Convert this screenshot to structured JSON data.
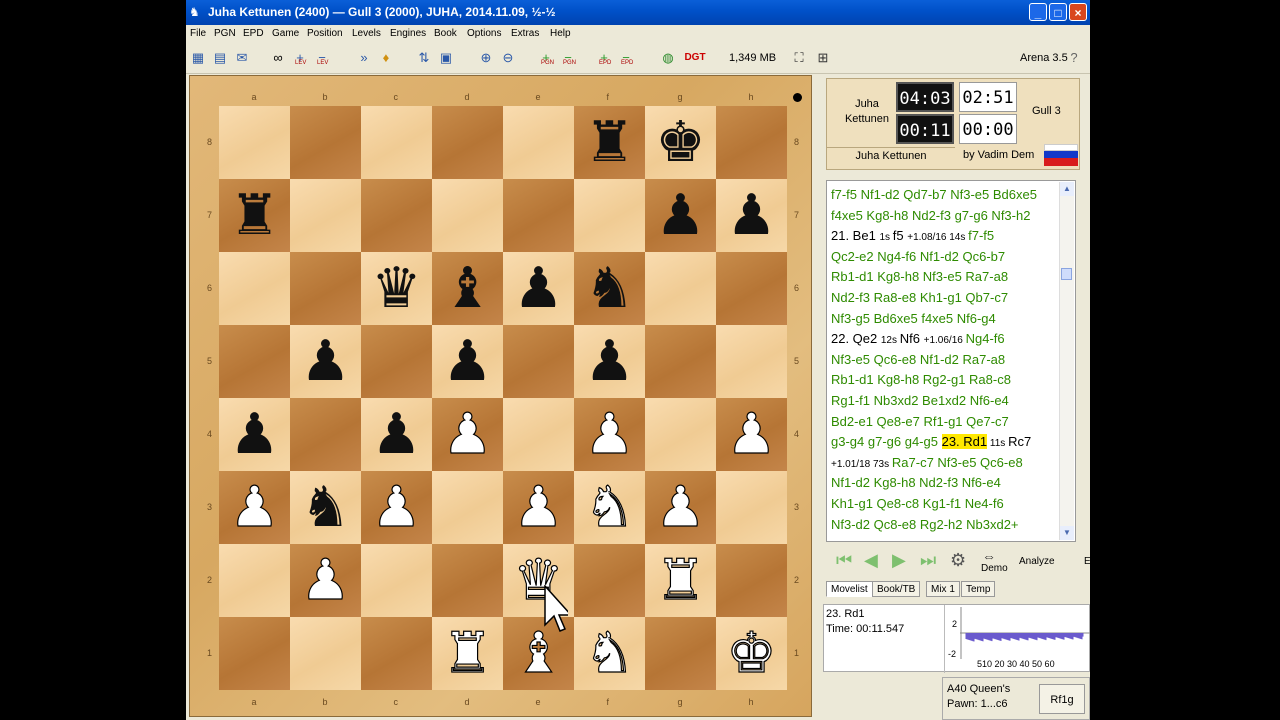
{
  "window": {
    "title": "Juha Kettunen (2400)  —  Gull 3 (2000),  JUHA,  2014.11.09,  ½-½",
    "controls": [
      "_",
      "□",
      "×"
    ]
  },
  "menu": [
    "File",
    "PGN",
    "EPD",
    "Game",
    "Position",
    "Levels",
    "Engines",
    "Book",
    "Options",
    "Extras",
    "Help"
  ],
  "toolbar": {
    "memory": "1,349 MB",
    "version": "Arena 3.5",
    "help": "?",
    "sublabels": [
      "LEV",
      "LEV",
      "PGN",
      "PGN",
      "EPD",
      "EPD"
    ],
    "dgt": "DGT"
  },
  "board": {
    "files": [
      "a",
      "b",
      "c",
      "d",
      "e",
      "f",
      "g",
      "h"
    ],
    "ranks": [
      "8",
      "7",
      "6",
      "5",
      "4",
      "3",
      "2",
      "1"
    ],
    "position": [
      [
        "",
        "",
        "",
        "",
        "",
        "r",
        "k",
        ""
      ],
      [
        "r",
        "",
        "",
        "",
        "",
        "",
        "p",
        "p"
      ],
      [
        "",
        "",
        "q",
        "b",
        "p",
        "n",
        "",
        ""
      ],
      [
        "",
        "p",
        "",
        "p",
        "",
        "p",
        "",
        ""
      ],
      [
        "p",
        "",
        "p",
        "P",
        "",
        "P",
        "",
        "P"
      ],
      [
        "P",
        "n",
        "P",
        "",
        "P",
        "N",
        "P",
        ""
      ],
      [
        "",
        "P",
        "",
        "",
        "Q",
        "",
        "R",
        ""
      ],
      [
        "",
        "",
        "",
        "R",
        "B",
        "N",
        "",
        "K"
      ]
    ]
  },
  "clock": {
    "white_name": "Juha Kettunen",
    "white_label_short": [
      "Juha",
      "Kettunen"
    ],
    "black_name": "Gull 3",
    "white_total": "04:03",
    "white_move": "00:11",
    "black_total": "02:51",
    "black_move": "00:00",
    "author": "by Vadim Dem"
  },
  "movelist": {
    "lines": [
      [
        {
          "t": "f7-f5 Nf1-d2 Qd7-b7 Nf3-e5 Bd6xe5",
          "c": "g"
        }
      ],
      [
        {
          "t": "f4xe5 Kg8-h8 Nd2-f3 g7-g6 Nf3-h2",
          "c": "g"
        }
      ],
      [
        {
          "t": "21. Be1 ",
          "c": "m"
        },
        {
          "t": "1s ",
          "c": "s"
        },
        {
          "t": "f5 ",
          "c": "m"
        },
        {
          "t": "+1.08/16 14s ",
          "c": "s"
        },
        {
          "t": " f7-f5",
          "c": "g"
        }
      ],
      [
        {
          "t": "Qc2-e2 Ng4-f6 Nf1-d2 Qc6-b7",
          "c": "g"
        }
      ],
      [
        {
          "t": "Rb1-d1 Kg8-h8 Nf3-e5 Ra7-a8",
          "c": "g"
        }
      ],
      [
        {
          "t": "Nd2-f3 Ra8-e8 Kh1-g1 Qb7-c7",
          "c": "g"
        }
      ],
      [
        {
          "t": "Nf3-g5 Bd6xe5 f4xe5 Nf6-g4",
          "c": "g"
        }
      ],
      [
        {
          "t": "22. Qe2 ",
          "c": "m"
        },
        {
          "t": "12s ",
          "c": "s"
        },
        {
          "t": "Nf6 ",
          "c": "m"
        },
        {
          "t": "+1.06/16 ",
          "c": "s"
        },
        {
          "t": "  Ng4-f6",
          "c": "g"
        }
      ],
      [
        {
          "t": "Nf3-e5 Qc6-e8 Nf1-d2 Ra7-a8",
          "c": "g"
        }
      ],
      [
        {
          "t": "Rb1-d1 Kg8-h8 Rg2-g1 Ra8-c8",
          "c": "g"
        }
      ],
      [
        {
          "t": "Rg1-f1 Nb3xd2 Be1xd2 Nf6-e4",
          "c": "g"
        }
      ],
      [
        {
          "t": "Bd2-e1 Qe8-e7 Rf1-g1 Qe7-c7",
          "c": "g"
        }
      ],
      [
        {
          "t": "g3-g4 g7-g6 g4-g5 ",
          "c": "g"
        },
        {
          "t": "23. Rd1",
          "c": "h"
        },
        {
          "t": " 11s ",
          "c": "s"
        },
        {
          "t": "Rc7",
          "c": "m"
        }
      ],
      [
        {
          "t": "+1.01/18 73s ",
          "c": "s"
        },
        {
          "t": "  Ra7-c7 Nf3-e5 Qc6-e8",
          "c": "g"
        }
      ],
      [
        {
          "t": "Nf1-d2 Kg8-h8 Nd2-f3 Nf6-e4",
          "c": "g"
        }
      ],
      [
        {
          "t": "Kh1-g1 Qe8-c8 Kg1-f1 Ne4-f6",
          "c": "g"
        }
      ],
      [
        {
          "t": "Nf3-d2 Qc8-e8 Rg2-h2 Nb3xd2+",
          "c": "g"
        }
      ]
    ]
  },
  "controls": {
    "demo": "Demo",
    "analyze": "Analyze",
    "e": "E"
  },
  "tabs": [
    "Movelist",
    "Book/TB",
    "Mix 1",
    "Temp"
  ],
  "info": {
    "move": "23. Rd1",
    "time": "Time: 00:11.547",
    "graph_y": [
      "2",
      "-2"
    ],
    "graph_x": "510 20 30 40 50 60"
  },
  "eco": {
    "line1": "A40  Queen's",
    "line2": "Pawn: 1...c6",
    "button": "Rf1g"
  }
}
